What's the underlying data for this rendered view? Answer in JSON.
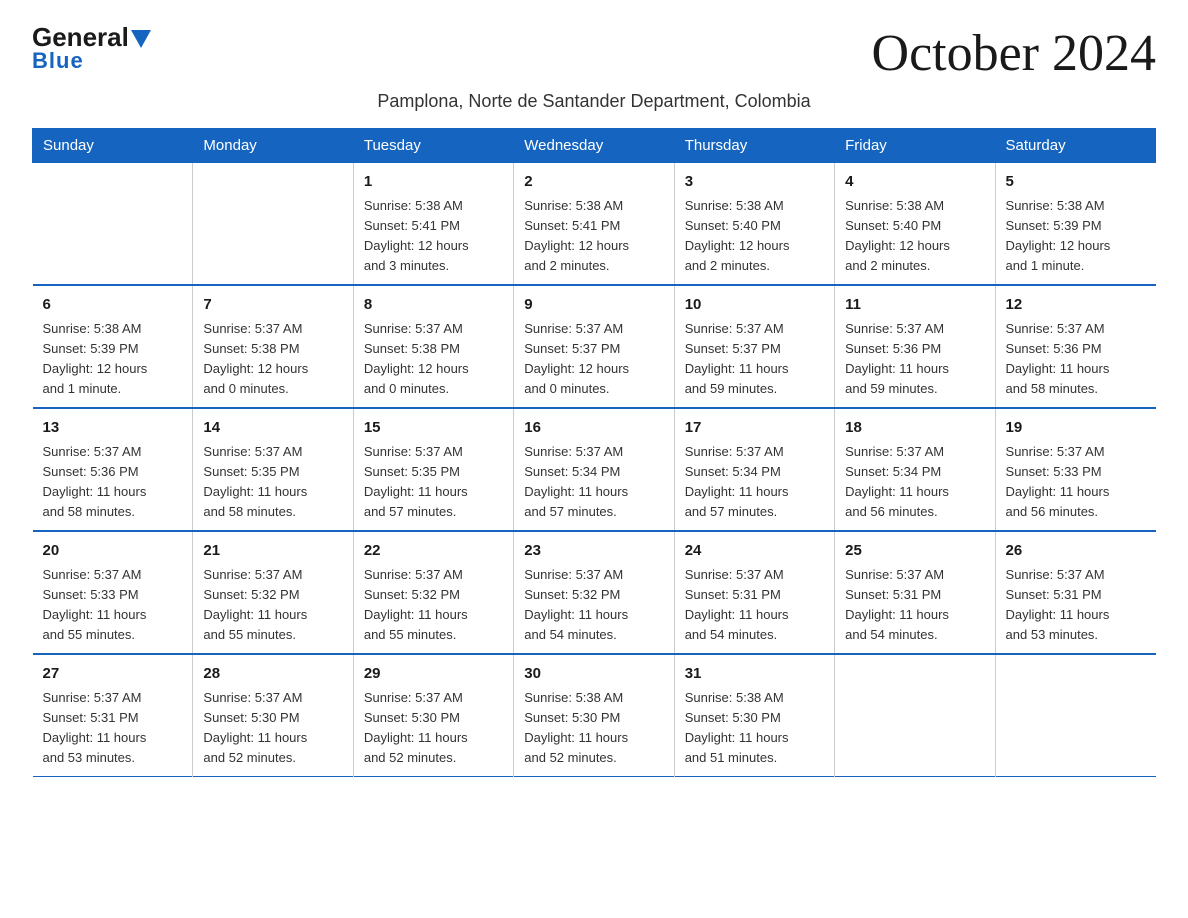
{
  "header": {
    "logo_general": "General",
    "logo_blue": "Blue",
    "month_title": "October 2024",
    "subtitle": "Pamplona, Norte de Santander Department, Colombia"
  },
  "days_of_week": [
    "Sunday",
    "Monday",
    "Tuesday",
    "Wednesday",
    "Thursday",
    "Friday",
    "Saturday"
  ],
  "weeks": [
    [
      {
        "day": "",
        "info": ""
      },
      {
        "day": "",
        "info": ""
      },
      {
        "day": "1",
        "info": "Sunrise: 5:38 AM\nSunset: 5:41 PM\nDaylight: 12 hours\nand 3 minutes."
      },
      {
        "day": "2",
        "info": "Sunrise: 5:38 AM\nSunset: 5:41 PM\nDaylight: 12 hours\nand 2 minutes."
      },
      {
        "day": "3",
        "info": "Sunrise: 5:38 AM\nSunset: 5:40 PM\nDaylight: 12 hours\nand 2 minutes."
      },
      {
        "day": "4",
        "info": "Sunrise: 5:38 AM\nSunset: 5:40 PM\nDaylight: 12 hours\nand 2 minutes."
      },
      {
        "day": "5",
        "info": "Sunrise: 5:38 AM\nSunset: 5:39 PM\nDaylight: 12 hours\nand 1 minute."
      }
    ],
    [
      {
        "day": "6",
        "info": "Sunrise: 5:38 AM\nSunset: 5:39 PM\nDaylight: 12 hours\nand 1 minute."
      },
      {
        "day": "7",
        "info": "Sunrise: 5:37 AM\nSunset: 5:38 PM\nDaylight: 12 hours\nand 0 minutes."
      },
      {
        "day": "8",
        "info": "Sunrise: 5:37 AM\nSunset: 5:38 PM\nDaylight: 12 hours\nand 0 minutes."
      },
      {
        "day": "9",
        "info": "Sunrise: 5:37 AM\nSunset: 5:37 PM\nDaylight: 12 hours\nand 0 minutes."
      },
      {
        "day": "10",
        "info": "Sunrise: 5:37 AM\nSunset: 5:37 PM\nDaylight: 11 hours\nand 59 minutes."
      },
      {
        "day": "11",
        "info": "Sunrise: 5:37 AM\nSunset: 5:36 PM\nDaylight: 11 hours\nand 59 minutes."
      },
      {
        "day": "12",
        "info": "Sunrise: 5:37 AM\nSunset: 5:36 PM\nDaylight: 11 hours\nand 58 minutes."
      }
    ],
    [
      {
        "day": "13",
        "info": "Sunrise: 5:37 AM\nSunset: 5:36 PM\nDaylight: 11 hours\nand 58 minutes."
      },
      {
        "day": "14",
        "info": "Sunrise: 5:37 AM\nSunset: 5:35 PM\nDaylight: 11 hours\nand 58 minutes."
      },
      {
        "day": "15",
        "info": "Sunrise: 5:37 AM\nSunset: 5:35 PM\nDaylight: 11 hours\nand 57 minutes."
      },
      {
        "day": "16",
        "info": "Sunrise: 5:37 AM\nSunset: 5:34 PM\nDaylight: 11 hours\nand 57 minutes."
      },
      {
        "day": "17",
        "info": "Sunrise: 5:37 AM\nSunset: 5:34 PM\nDaylight: 11 hours\nand 57 minutes."
      },
      {
        "day": "18",
        "info": "Sunrise: 5:37 AM\nSunset: 5:34 PM\nDaylight: 11 hours\nand 56 minutes."
      },
      {
        "day": "19",
        "info": "Sunrise: 5:37 AM\nSunset: 5:33 PM\nDaylight: 11 hours\nand 56 minutes."
      }
    ],
    [
      {
        "day": "20",
        "info": "Sunrise: 5:37 AM\nSunset: 5:33 PM\nDaylight: 11 hours\nand 55 minutes."
      },
      {
        "day": "21",
        "info": "Sunrise: 5:37 AM\nSunset: 5:32 PM\nDaylight: 11 hours\nand 55 minutes."
      },
      {
        "day": "22",
        "info": "Sunrise: 5:37 AM\nSunset: 5:32 PM\nDaylight: 11 hours\nand 55 minutes."
      },
      {
        "day": "23",
        "info": "Sunrise: 5:37 AM\nSunset: 5:32 PM\nDaylight: 11 hours\nand 54 minutes."
      },
      {
        "day": "24",
        "info": "Sunrise: 5:37 AM\nSunset: 5:31 PM\nDaylight: 11 hours\nand 54 minutes."
      },
      {
        "day": "25",
        "info": "Sunrise: 5:37 AM\nSunset: 5:31 PM\nDaylight: 11 hours\nand 54 minutes."
      },
      {
        "day": "26",
        "info": "Sunrise: 5:37 AM\nSunset: 5:31 PM\nDaylight: 11 hours\nand 53 minutes."
      }
    ],
    [
      {
        "day": "27",
        "info": "Sunrise: 5:37 AM\nSunset: 5:31 PM\nDaylight: 11 hours\nand 53 minutes."
      },
      {
        "day": "28",
        "info": "Sunrise: 5:37 AM\nSunset: 5:30 PM\nDaylight: 11 hours\nand 52 minutes."
      },
      {
        "day": "29",
        "info": "Sunrise: 5:37 AM\nSunset: 5:30 PM\nDaylight: 11 hours\nand 52 minutes."
      },
      {
        "day": "30",
        "info": "Sunrise: 5:38 AM\nSunset: 5:30 PM\nDaylight: 11 hours\nand 52 minutes."
      },
      {
        "day": "31",
        "info": "Sunrise: 5:38 AM\nSunset: 5:30 PM\nDaylight: 11 hours\nand 51 minutes."
      },
      {
        "day": "",
        "info": ""
      },
      {
        "day": "",
        "info": ""
      }
    ]
  ]
}
